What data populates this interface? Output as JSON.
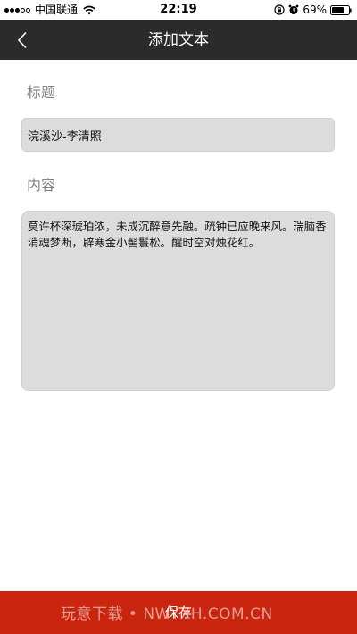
{
  "status_bar": {
    "carrier": "中国联通",
    "time": "22:19",
    "battery": "69%"
  },
  "nav": {
    "title": "添加文本"
  },
  "form": {
    "title_label": "标题",
    "title_value": "浣溪沙-李清照",
    "content_label": "内容",
    "content_value": "莫许杯深琥珀浓，未成沉醉意先融。疏钟已应晚来风。瑞脑香消魂梦断，辟寒金小髻鬟松。醒时空对烛花红。"
  },
  "footer": {
    "save_label": "保存",
    "watermark": "玩意下载 • NWYXH.COM.CN"
  },
  "colors": {
    "nav_background": "#2b2b2b",
    "save_bar": "#c9250f",
    "field_background": "#dcdcdc",
    "label_text": "#808080"
  },
  "icons": {
    "back": "chevron-left-icon",
    "wifi": "wifi-icon",
    "lock": "rotation-lock-icon",
    "alarm": "alarm-icon",
    "battery": "battery-icon"
  }
}
